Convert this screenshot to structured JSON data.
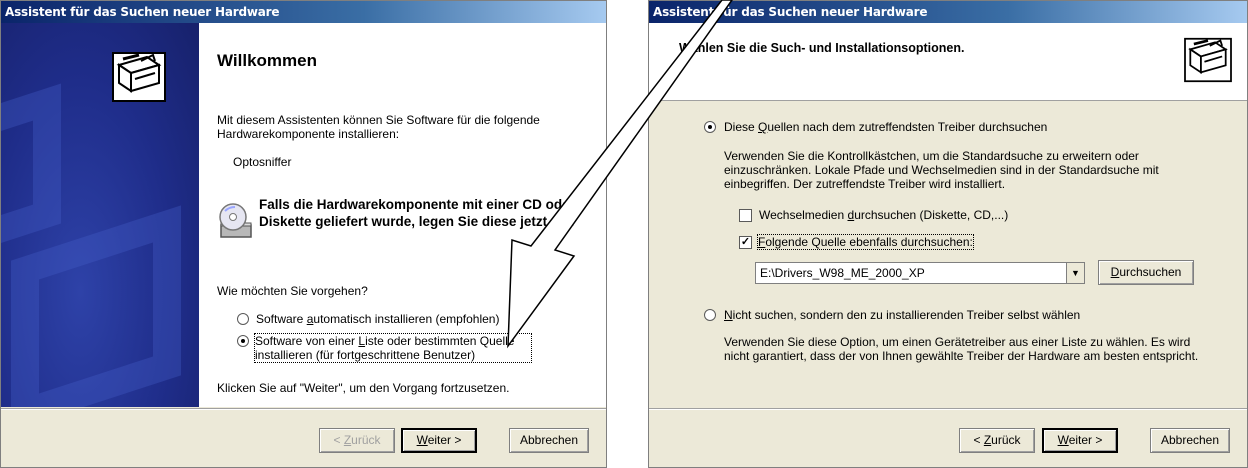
{
  "left_dialog": {
    "title": "Assistent für das Suchen neuer Hardware",
    "heading": "Willkommen",
    "intro": "Mit diesem Assistenten können Sie Software für die folgende Hardwarekomponente installieren:",
    "device_name": "Optosniffer",
    "cd_note": "Falls die Hardwarekomponente mit einer CD oder Diskette geliefert wurde, legen Sie diese jetzt ein.",
    "question": "Wie möchten Sie vorgehen?",
    "option_auto_pre": "Software ",
    "option_auto_u": "a",
    "option_auto_post": "utomatisch installieren (empfohlen)",
    "option_list_pre": "Software von einer ",
    "option_list_u": "L",
    "option_list_post": "iste oder bestimmten Quelle",
    "option_list_line2": "installieren (für fortgeschrittene Benutzer)",
    "continue_hint": "Klicken Sie auf \"Weiter\", um den Vorgang fortzusetzen.",
    "back_pre": "< ",
    "back_u": "Z",
    "back_post": "urück",
    "next_u": "W",
    "next_post": "eiter >",
    "cancel": "Abbrechen",
    "selected_option": "list"
  },
  "right_dialog": {
    "title": "Assistent für das Suchen neuer Hardware",
    "heading": "Wählen Sie die Such- und Installationsoptionen.",
    "option_search_pre": "Diese ",
    "option_search_u": "Q",
    "option_search_post": "uellen nach dem zutreffendsten Treiber durchsuchen",
    "search_desc_1": "Verwenden Sie die Kontrollkästchen, um die Standardsuche zu erweitern oder",
    "search_desc_2": "einzuschränken. Lokale Pfade und Wechselmedien sind in der Standardsuche mit",
    "search_desc_3": "einbegriffen. Der zutreffendste Treiber wird installiert.",
    "check_removable_pre": "Wechselmedien ",
    "check_removable_u": "d",
    "check_removable_post": "urchsuchen (Diskette, CD,...)",
    "check_removable_checked": false,
    "check_path_u": "F",
    "check_path_post": "olgende Quelle ebenfalls durchsuchen:",
    "check_path_checked": true,
    "path_value": "E:\\Drivers_W98_ME_2000_XP",
    "browse_u": "D",
    "browse_post": "urchsuchen",
    "option_manual_u": "N",
    "option_manual_post": "icht suchen, sondern den zu installierenden Treiber selbst wählen",
    "manual_desc_1": "Verwenden Sie diese Option, um einen Gerätetreiber aus einer Liste zu wählen. Es wird",
    "manual_desc_2": "nicht garantiert, dass der von Ihnen gewählte Treiber der Hardware am besten entspricht.",
    "back_pre": "< ",
    "back_u": "Z",
    "back_post": "urück",
    "next_u": "W",
    "next_post": "eiter >",
    "cancel": "Abbrechen",
    "selected_option": "search"
  },
  "icons": [
    "hardware-wizard-icon",
    "cd-drive-icon",
    "annotation-arrow"
  ]
}
